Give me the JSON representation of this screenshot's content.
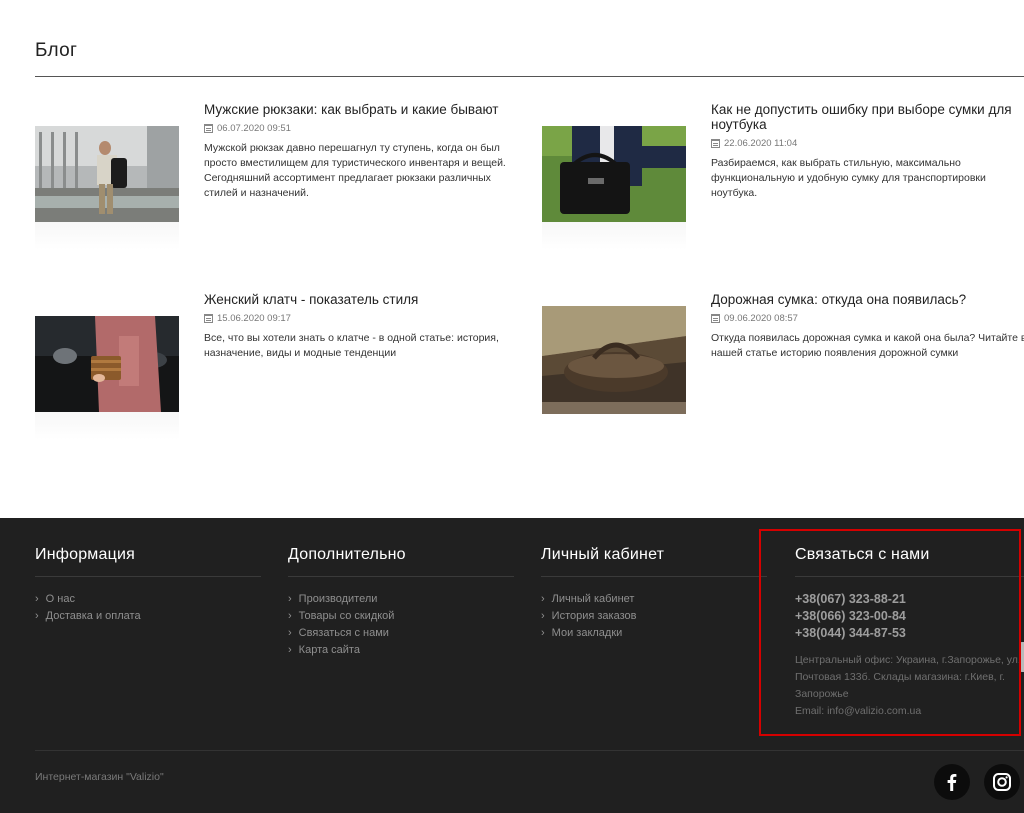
{
  "page": {
    "title": "Блог"
  },
  "posts": [
    {
      "title": "Мужские рюкзаки: как выбрать и какие бывают",
      "date": "06.07.2020 09:51",
      "excerpt": "Мужской рюкзак давно перешагнул ту ступень, когда он был просто вместилищем для туристического инвентаря и вещей. Сегодняшний ассортимент предлагает рюкзаки различных стилей и назначений."
    },
    {
      "title": "Как не допустить ошибку при выборе сумки для ноутбука",
      "date": "22.06.2020 11:04",
      "excerpt": "Разбираемся, как выбрать стильную, максимально функциональную и удобную сумку для транспортировки ноутбука."
    },
    {
      "title": "Женский клатч - показатель стиля",
      "date": "15.06.2020 09:17",
      "excerpt": "Все, что вы хотели знать о клатче - в одной статье: история, назначение, виды и модные тенденции"
    },
    {
      "title": "Дорожная сумка: откуда она появилась?",
      "date": "09.06.2020 08:57",
      "excerpt": "Откуда появилась дорожная сумка и какой она была? Читайте в нашей статье историю появления дорожной сумки"
    }
  ],
  "footer": {
    "info": {
      "heading": "Информация",
      "links": [
        "О нас",
        "Доставка и оплата"
      ]
    },
    "extra": {
      "heading": "Дополнительно",
      "links": [
        "Производители",
        "Товары со скидкой",
        "Связаться с нами",
        "Карта сайта"
      ]
    },
    "account": {
      "heading": "Личный кабинет",
      "links": [
        "Личный кабинет",
        "История заказов",
        "Мои закладки"
      ]
    },
    "contact": {
      "heading": "Связаться с нами",
      "phones": [
        "+38(067) 323-88-21",
        "+38(066) 323-00-84",
        "+38(044) 344-87-53"
      ],
      "address": "Центральный офис: Украина, г.Запорожье, ул. Почтовая 133б. Склады магазина: г.Киев, г. Запорожье",
      "email": "Email: info@valizio.com.ua"
    },
    "copyright": "Интернет-магазин \"Valizio\"",
    "social": [
      {
        "icon": "facebook-icon"
      },
      {
        "icon": "instagram-icon"
      }
    ]
  },
  "colors": {
    "footer_bg": "#202020",
    "highlight": "#d50000",
    "text_dark": "#222222"
  }
}
